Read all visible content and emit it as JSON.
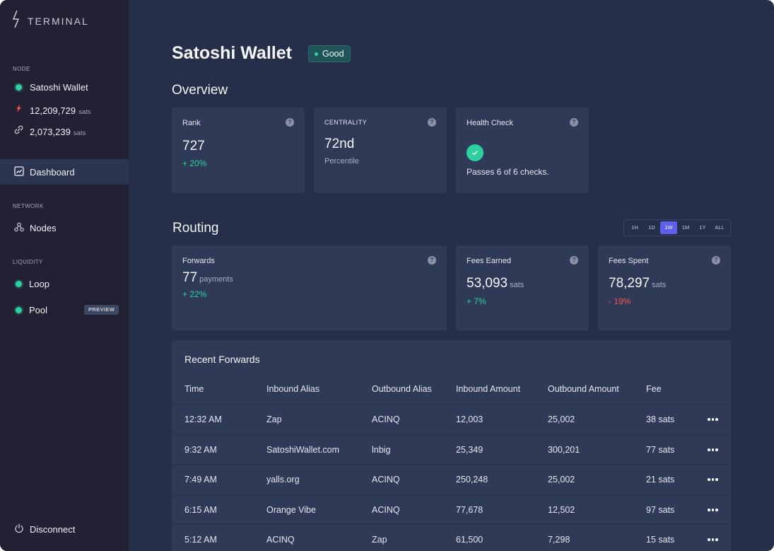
{
  "brand": {
    "name": "TERMINAL"
  },
  "sidebar": {
    "node_label": "NODE",
    "node": {
      "alias": "Satoshi Wallet",
      "balance_1": "12,209,729",
      "balance_1_unit": "sats",
      "balance_2": "2,073,239",
      "balance_2_unit": "sats"
    },
    "dashboard": "Dashboard",
    "network_label": "NETWORK",
    "nodes": "Nodes",
    "liquidity_label": "LIQUIDITY",
    "loop": "Loop",
    "pool": "Pool",
    "pool_badge": "PREVIEW",
    "disconnect": "Disconnect"
  },
  "header": {
    "title": "Satoshi Wallet",
    "status": "Good"
  },
  "overview": {
    "heading": "Overview",
    "rank": {
      "label": "Rank",
      "value": "727",
      "change": "+ 20%"
    },
    "centrality": {
      "label": "CENTRALITY",
      "value": "72nd",
      "sub": "Percentile"
    },
    "health": {
      "label": "Health Check",
      "text": "Passes 6 of 6 checks."
    }
  },
  "routing": {
    "heading": "Routing",
    "ranges": [
      "1H",
      "1D",
      "1W",
      "1M",
      "1Y",
      "ALL"
    ],
    "active_range": "1W",
    "forwards": {
      "label": "Forwards",
      "value": "77",
      "unit": "payments",
      "change": "+ 22%"
    },
    "fees_earned": {
      "label": "Fees Earned",
      "value": "53,093",
      "unit": "sats",
      "change": "+ 7%"
    },
    "fees_spent": {
      "label": "Fees Spent",
      "value": "78,297",
      "unit": "sats",
      "change": "- 19%"
    }
  },
  "recent": {
    "title": "Recent Forwards",
    "columns": [
      "Time",
      "Inbound Alias",
      "Outbound Alias",
      "Inbound Amount",
      "Outbound Amount",
      "Fee"
    ],
    "rows": [
      [
        "12:32 AM",
        "Zap",
        "ACINQ",
        "12,003",
        "25,002",
        "38 sats"
      ],
      [
        "9:32 AM",
        "SatoshiWallet.com",
        "lnbig",
        "25,349",
        "300,201",
        "77 sats"
      ],
      [
        "7:49 AM",
        "yalls.org",
        "ACINQ",
        "250,248",
        "25,002",
        "21 sats"
      ],
      [
        "6:15 AM",
        "Orange Vibe",
        "ACINQ",
        "77,678",
        "12,502",
        "97 sats"
      ],
      [
        "5:12 AM",
        "ACINQ",
        "Zap",
        "61,500",
        "7,298",
        "15 sats"
      ]
    ]
  },
  "colors": {
    "accent": "#5d5fef",
    "positive": "#2fd0a0",
    "negative": "#f3564e",
    "sidebar": "#212133",
    "background": "#252f4a",
    "card": "#2f3a57"
  },
  "icons": [
    "terminal-logo-icon",
    "node-status-dot-icon",
    "lightning-icon",
    "link-icon",
    "chart-icon",
    "nodes-icon",
    "help-icon",
    "check-icon",
    "more-icon",
    "power-icon"
  ]
}
